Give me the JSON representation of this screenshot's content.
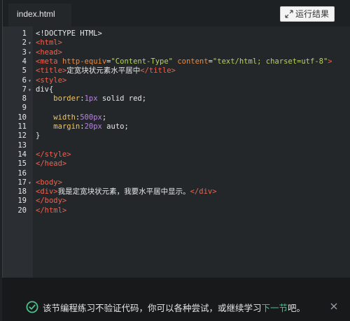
{
  "tab": {
    "label": "index.html"
  },
  "run_button": {
    "label": "运行结果"
  },
  "code_lines": [
    {
      "n": "1",
      "fold": "",
      "segs": [
        [
          "plain",
          "<!DOCTYPE HTML>"
        ]
      ]
    },
    {
      "n": "2",
      "fold": "▾",
      "segs": [
        [
          "tag",
          "<html>"
        ]
      ]
    },
    {
      "n": "3",
      "fold": "▾",
      "segs": [
        [
          "tag",
          "<head>"
        ]
      ]
    },
    {
      "n": "4",
      "fold": "",
      "segs": [
        [
          "tag",
          "<meta "
        ],
        [
          "attr",
          "http-equiv"
        ],
        [
          "plain",
          "="
        ],
        [
          "str",
          "\"Content-Type\""
        ],
        [
          "plain",
          " "
        ],
        [
          "attr",
          "content"
        ],
        [
          "plain",
          "="
        ],
        [
          "str",
          "\"text/html; charset=utf-8\""
        ],
        [
          "tag",
          ">"
        ]
      ]
    },
    {
      "n": "5",
      "fold": "",
      "segs": [
        [
          "tag",
          "<title>"
        ],
        [
          "plain",
          "定宽块状元素水平居中"
        ],
        [
          "tag",
          "</title>"
        ]
      ]
    },
    {
      "n": "6",
      "fold": "▾",
      "segs": [
        [
          "tag",
          "<style>"
        ]
      ]
    },
    {
      "n": "7",
      "fold": "▾",
      "segs": [
        [
          "plain",
          "div{"
        ]
      ]
    },
    {
      "n": "8",
      "fold": "",
      "segs": [
        [
          "plain",
          "    "
        ],
        [
          "prop",
          "border"
        ],
        [
          "plain",
          ":"
        ],
        [
          "num",
          "1px"
        ],
        [
          "plain",
          " solid red;"
        ]
      ]
    },
    {
      "n": "9",
      "fold": "",
      "segs": []
    },
    {
      "n": "10",
      "fold": "",
      "segs": [
        [
          "plain",
          "    "
        ],
        [
          "prop",
          "width"
        ],
        [
          "plain",
          ":"
        ],
        [
          "num",
          "500px"
        ],
        [
          "plain",
          ";"
        ]
      ]
    },
    {
      "n": "11",
      "fold": "",
      "segs": [
        [
          "plain",
          "    "
        ],
        [
          "prop",
          "margin"
        ],
        [
          "plain",
          ":"
        ],
        [
          "num",
          "20px"
        ],
        [
          "plain",
          " auto;"
        ]
      ]
    },
    {
      "n": "12",
      "fold": "",
      "segs": [
        [
          "plain",
          "}"
        ]
      ]
    },
    {
      "n": "13",
      "fold": "",
      "segs": []
    },
    {
      "n": "14",
      "fold": "",
      "segs": [
        [
          "tag",
          "</style>"
        ]
      ]
    },
    {
      "n": "15",
      "fold": "",
      "segs": [
        [
          "tag",
          "</head>"
        ]
      ]
    },
    {
      "n": "16",
      "fold": "",
      "segs": []
    },
    {
      "n": "17",
      "fold": "▾",
      "segs": [
        [
          "tag",
          "<body>"
        ]
      ]
    },
    {
      "n": "18",
      "fold": "",
      "segs": [
        [
          "tag",
          "<div>"
        ],
        [
          "plain",
          "我是定宽块状元素，我要水平居中显示。"
        ],
        [
          "tag",
          "</div>"
        ]
      ]
    },
    {
      "n": "19",
      "fold": "",
      "segs": [
        [
          "tag",
          "</body>"
        ]
      ]
    },
    {
      "n": "20",
      "fold": "",
      "segs": [
        [
          "tag",
          "</html>"
        ]
      ]
    }
  ],
  "notice": {
    "text_before": "该节编程练习不验证代码，你可以各种尝试，或继续学习",
    "link": "下一节",
    "text_after": "吧。"
  },
  "icons": {
    "run": "expand-arrows-icon",
    "notice": "check-circle-icon",
    "close": "close-icon"
  },
  "colors": {
    "background": "#23272a",
    "tag": "#f0624e",
    "attr": "#ef8a3a",
    "string": "#b6d35a",
    "property": "#f1c764",
    "number": "#b784e0",
    "accent": "#4fc08d"
  }
}
